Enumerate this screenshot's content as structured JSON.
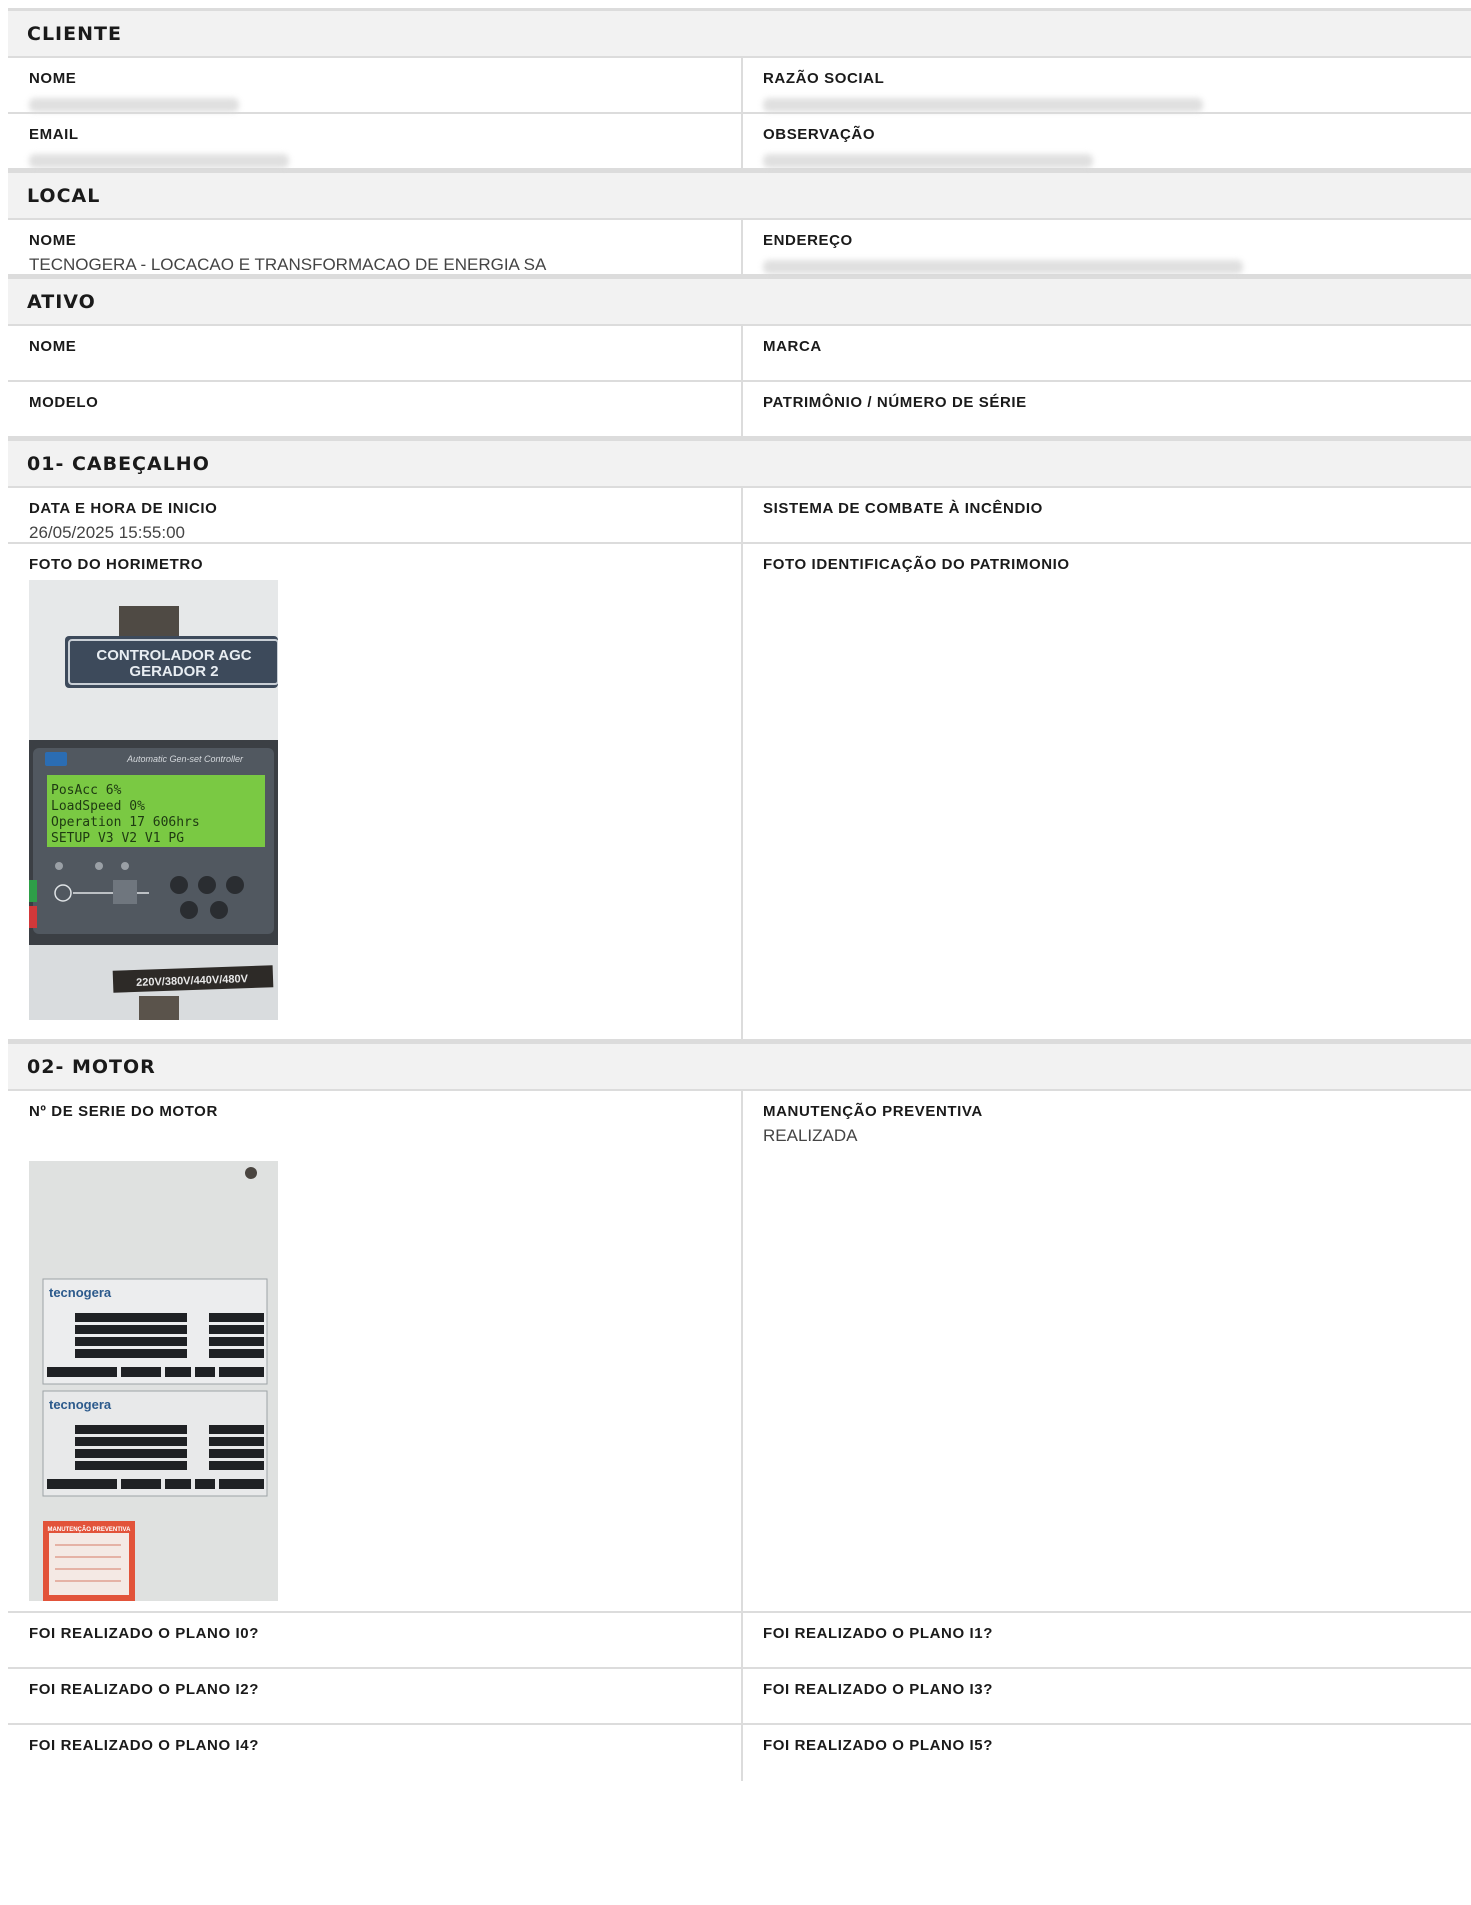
{
  "sections": {
    "cliente": {
      "title": "CLIENTE",
      "nome_label": "NOME",
      "razao_label": "RAZÃO SOCIAL",
      "email_label": "EMAIL",
      "obs_label": "OBSERVAÇÃO"
    },
    "local": {
      "title": "LOCAL",
      "nome_label": "NOME",
      "nome_value": "TECNOGERA - LOCACAO E TRANSFORMACAO DE ENERGIA SA",
      "endereco_label": "ENDEREÇO"
    },
    "ativo": {
      "title": "ATIVO",
      "nome_label": "NOME",
      "marca_label": "MARCA",
      "modelo_label": "MODELO",
      "patrimonio_label": "PATRIMÔNIO / NÚMERO DE SÉRIE"
    },
    "cabecalho": {
      "title": "01- CABEÇALHO",
      "data_label": "DATA E HORA DE INICIO",
      "data_value": "26/05/2025 15:55:00",
      "sistema_label": "SISTEMA DE COMBATE À INCÊNDIO",
      "foto_horimetro_label": "FOTO DO HORIMETRO",
      "foto_patrimonio_label": "FOTO IDENTIFICAÇÃO DO PATRIMONIO"
    },
    "motor": {
      "title": "02- MOTOR",
      "serie_label": "Nº DE SERIE DO MOTOR",
      "manutencao_label": "MANUTENÇÃO PREVENTIVA",
      "manutencao_value": "REALIZADA",
      "plano_i0": "FOI REALIZADO O PLANO I0?",
      "plano_i1": "FOI REALIZADO O PLANO I1?",
      "plano_i2": "FOI REALIZADO O PLANO I2?",
      "plano_i3": "FOI REALIZADO O PLANO I3?",
      "plano_i4": "FOI REALIZADO O PLANO I4?",
      "plano_i5": "FOI REALIZADO O PLANO I5?"
    }
  },
  "photo_text": {
    "controller_title_1": "CONTROLADOR AGC",
    "controller_title_2": "GERADOR 2",
    "controller_brand": "Automatic Gen-set Controller",
    "lcd_line_1": "PosAcc        6%",
    "lcd_line_2": "LoadSpeed     0%",
    "lcd_line_3": "Operation  17 606hrs",
    "lcd_line_4": "SETUP V3 V2 V1  PG",
    "voltage_plate": "220V/380V/440V/480V",
    "plate_brand_1": "tecnogera",
    "plate_brand_2": "tecnogera",
    "maint_tag": "MANUTENÇÃO PREVENTIVA"
  },
  "colors": {
    "header_bg": "#f2f2f2",
    "border": "#dcdcdc",
    "lcd_green": "#7ac943"
  }
}
